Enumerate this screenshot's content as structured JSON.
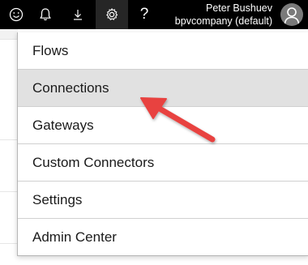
{
  "topbar": {
    "icons": [
      {
        "name": "smiley-icon"
      },
      {
        "name": "bell-icon"
      },
      {
        "name": "download-icon"
      },
      {
        "name": "gear-icon"
      },
      {
        "name": "help-icon",
        "glyph": "?"
      }
    ],
    "user_name": "Peter Bushuev",
    "environment": "bpvcompany (default)",
    "avatar_icon": "person-icon"
  },
  "menu": {
    "items": [
      {
        "label": "Flows"
      },
      {
        "label": "Connections"
      },
      {
        "label": "Gateways"
      },
      {
        "label": "Custom Connectors"
      },
      {
        "label": "Settings"
      },
      {
        "label": "Admin Center"
      }
    ],
    "highlighted_item": "Connections"
  },
  "annotation": {
    "arrow_color": "#e8423f",
    "arrow_target": "Connections"
  },
  "colors": {
    "topbar_bg": "#000000",
    "highlight_bg": "#e1e1e1"
  }
}
